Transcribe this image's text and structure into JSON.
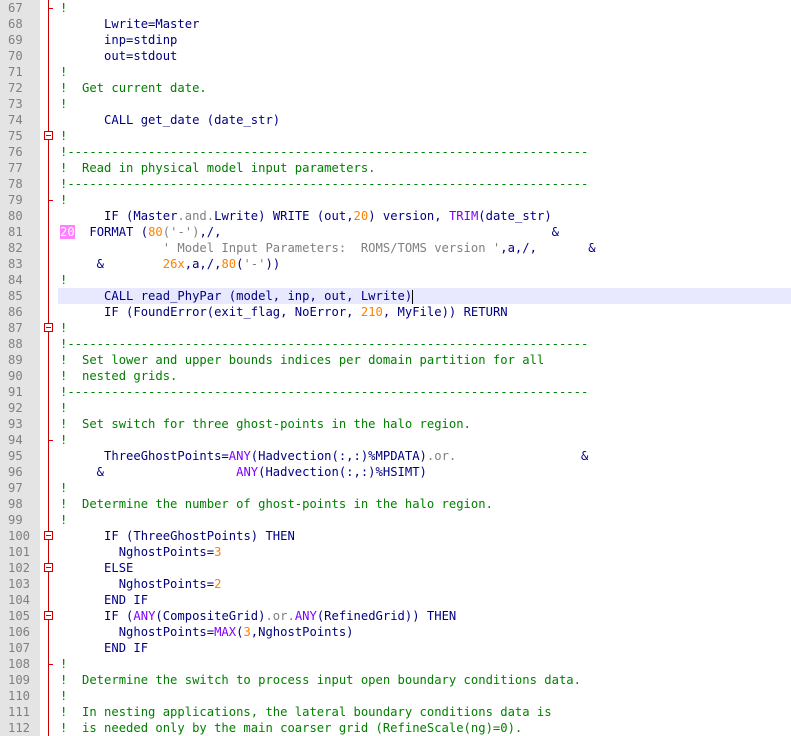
{
  "editor": {
    "language": "fortran",
    "current_line": 85,
    "lines": [
      {
        "n": "67",
        "fold": "end",
        "tokens": [
          [
            "cm",
            "!"
          ]
        ]
      },
      {
        "n": "68",
        "fold": "line",
        "tokens": [
          [
            "id",
            "      Lwrite=Master"
          ]
        ]
      },
      {
        "n": "69",
        "fold": "line",
        "tokens": [
          [
            "id",
            "      inp=stdinp"
          ]
        ]
      },
      {
        "n": "70",
        "fold": "line",
        "tokens": [
          [
            "id",
            "      out=stdout"
          ]
        ]
      },
      {
        "n": "71",
        "fold": "line",
        "tokens": [
          [
            "cm",
            "!"
          ]
        ]
      },
      {
        "n": "72",
        "fold": "line",
        "tokens": [
          [
            "cm",
            "!  Get current date."
          ]
        ]
      },
      {
        "n": "73",
        "fold": "line",
        "tokens": [
          [
            "cm",
            "!"
          ]
        ]
      },
      {
        "n": "74",
        "fold": "line",
        "tokens": [
          [
            "kw",
            "      CALL "
          ],
          [
            "id",
            "get_date (date_str)"
          ]
        ]
      },
      {
        "n": "75",
        "fold": "box",
        "tokens": [
          [
            "cm",
            "!"
          ]
        ]
      },
      {
        "n": "76",
        "fold": "line",
        "tokens": [
          [
            "cm",
            "!-----------------------------------------------------------------------"
          ]
        ]
      },
      {
        "n": "77",
        "fold": "line",
        "tokens": [
          [
            "cm",
            "!  Read in physical model input parameters."
          ]
        ]
      },
      {
        "n": "78",
        "fold": "line",
        "tokens": [
          [
            "cm",
            "!-----------------------------------------------------------------------"
          ]
        ]
      },
      {
        "n": "79",
        "fold": "end",
        "tokens": [
          [
            "cm",
            "!"
          ]
        ]
      },
      {
        "n": "80",
        "fold": "line",
        "tokens": [
          [
            "kw",
            "      IF "
          ],
          [
            "id",
            "(Master"
          ],
          [
            "op",
            ".and."
          ],
          [
            "id",
            "Lwrite) "
          ],
          [
            "kw",
            "WRITE "
          ],
          [
            "id",
            "(out,"
          ],
          [
            "num",
            "20"
          ],
          [
            "id",
            ") version, "
          ],
          [
            "fn",
            "TRIM"
          ],
          [
            "id",
            "(date_str)"
          ]
        ]
      },
      {
        "n": "81",
        "fold": "line",
        "label": "20",
        "tokens": [
          [
            "id",
            "  "
          ],
          [
            "kw",
            "FORMAT "
          ],
          [
            "id",
            "("
          ],
          [
            "num",
            "80"
          ],
          [
            "str",
            "('-')"
          ],
          [
            "id",
            ",/,                                             "
          ],
          [
            "id",
            "&"
          ]
        ]
      },
      {
        "n": "82",
        "fold": "line",
        "tokens": [
          [
            "str",
            "              ' Model Input Parameters:  ROMS/TOMS version '"
          ],
          [
            "id",
            ",a,/,       &"
          ]
        ]
      },
      {
        "n": "83",
        "fold": "line",
        "tokens": [
          [
            "id",
            "     &        "
          ],
          [
            "num",
            "26x"
          ],
          [
            "id",
            ",a,/,"
          ],
          [
            "num",
            "80"
          ],
          [
            "id",
            "("
          ],
          [
            "str",
            "'-'"
          ],
          [
            "id",
            "))"
          ]
        ]
      },
      {
        "n": "84",
        "fold": "line",
        "tokens": [
          [
            "cm",
            "!"
          ]
        ]
      },
      {
        "n": "85",
        "fold": "line",
        "tokens": [
          [
            "kw",
            "      CALL "
          ],
          [
            "id",
            "read_PhyPar (model, inp, out, Lwrite)"
          ],
          [
            "caret",
            ""
          ]
        ]
      },
      {
        "n": "86",
        "fold": "line",
        "tokens": [
          [
            "kw",
            "      IF "
          ],
          [
            "id",
            "(FoundError(exit_flag, NoError, "
          ],
          [
            "num",
            "210"
          ],
          [
            "id",
            ", MyFile)) "
          ],
          [
            "kw",
            "RETURN"
          ]
        ]
      },
      {
        "n": "87",
        "fold": "box",
        "tokens": [
          [
            "cm",
            "!"
          ]
        ]
      },
      {
        "n": "88",
        "fold": "line",
        "tokens": [
          [
            "cm",
            "!-----------------------------------------------------------------------"
          ]
        ]
      },
      {
        "n": "89",
        "fold": "line",
        "tokens": [
          [
            "cm",
            "!  Set lower and upper bounds indices per domain partition for all"
          ]
        ]
      },
      {
        "n": "90",
        "fold": "line",
        "tokens": [
          [
            "cm",
            "!  nested grids."
          ]
        ]
      },
      {
        "n": "91",
        "fold": "line",
        "tokens": [
          [
            "cm",
            "!-----------------------------------------------------------------------"
          ]
        ]
      },
      {
        "n": "92",
        "fold": "line",
        "tokens": [
          [
            "cm",
            "!"
          ]
        ]
      },
      {
        "n": "93",
        "fold": "line",
        "tokens": [
          [
            "cm",
            "!  Set switch for three ghost-points in the halo region."
          ]
        ]
      },
      {
        "n": "94",
        "fold": "end",
        "tokens": [
          [
            "cm",
            "!"
          ]
        ]
      },
      {
        "n": "95",
        "fold": "line",
        "tokens": [
          [
            "id",
            "      ThreeGhostPoints="
          ],
          [
            "fn",
            "ANY"
          ],
          [
            "id",
            "(Hadvection(:,:)%MPDATA)"
          ],
          [
            "op",
            ".or."
          ],
          [
            "id",
            "                 &"
          ]
        ]
      },
      {
        "n": "96",
        "fold": "line",
        "tokens": [
          [
            "id",
            "     &                  "
          ],
          [
            "fn",
            "ANY"
          ],
          [
            "id",
            "(Hadvection(:,:)%HSIMT)"
          ]
        ]
      },
      {
        "n": "97",
        "fold": "line",
        "tokens": [
          [
            "cm",
            "!"
          ]
        ]
      },
      {
        "n": "98",
        "fold": "line",
        "tokens": [
          [
            "cm",
            "!  Determine the number of ghost-points in the halo region."
          ]
        ]
      },
      {
        "n": "99",
        "fold": "line",
        "tokens": [
          [
            "cm",
            "!"
          ]
        ]
      },
      {
        "n": "100",
        "fold": "box",
        "tokens": [
          [
            "kw",
            "      IF "
          ],
          [
            "id",
            "(ThreeGhostPoints) "
          ],
          [
            "kw",
            "THEN"
          ]
        ]
      },
      {
        "n": "101",
        "fold": "line",
        "tokens": [
          [
            "id",
            "        NghostPoints="
          ],
          [
            "num",
            "3"
          ]
        ]
      },
      {
        "n": "102",
        "fold": "box",
        "tokens": [
          [
            "kw",
            "      ELSE"
          ]
        ]
      },
      {
        "n": "103",
        "fold": "line",
        "tokens": [
          [
            "id",
            "        NghostPoints="
          ],
          [
            "num",
            "2"
          ]
        ]
      },
      {
        "n": "104",
        "fold": "line",
        "tokens": [
          [
            "kw",
            "      END IF"
          ]
        ]
      },
      {
        "n": "105",
        "fold": "box",
        "tokens": [
          [
            "kw",
            "      IF "
          ],
          [
            "id",
            "("
          ],
          [
            "fn",
            "ANY"
          ],
          [
            "id",
            "(CompositeGrid)"
          ],
          [
            "op",
            ".or."
          ],
          [
            "fn",
            "ANY"
          ],
          [
            "id",
            "(RefinedGrid)) "
          ],
          [
            "kw",
            "THEN"
          ]
        ]
      },
      {
        "n": "106",
        "fold": "line",
        "tokens": [
          [
            "id",
            "        NghostPoints="
          ],
          [
            "fn",
            "MAX"
          ],
          [
            "id",
            "("
          ],
          [
            "num",
            "3"
          ],
          [
            "id",
            ",NghostPoints)"
          ]
        ]
      },
      {
        "n": "107",
        "fold": "line",
        "tokens": [
          [
            "kw",
            "      END IF"
          ]
        ]
      },
      {
        "n": "108",
        "fold": "end",
        "tokens": [
          [
            "cm",
            "!"
          ]
        ]
      },
      {
        "n": "109",
        "fold": "line",
        "tokens": [
          [
            "cm",
            "!  Determine the switch to process input open boundary conditions data."
          ]
        ]
      },
      {
        "n": "110",
        "fold": "line",
        "tokens": [
          [
            "cm",
            "!"
          ]
        ]
      },
      {
        "n": "111",
        "fold": "line",
        "tokens": [
          [
            "cm",
            "!  In nesting applications, the lateral boundary conditions data is"
          ]
        ]
      },
      {
        "n": "112",
        "fold": "line",
        "tokens": [
          [
            "cm",
            "!  is needed only by the main coarser grid (RefineScale(ng)=0)."
          ]
        ]
      }
    ]
  }
}
